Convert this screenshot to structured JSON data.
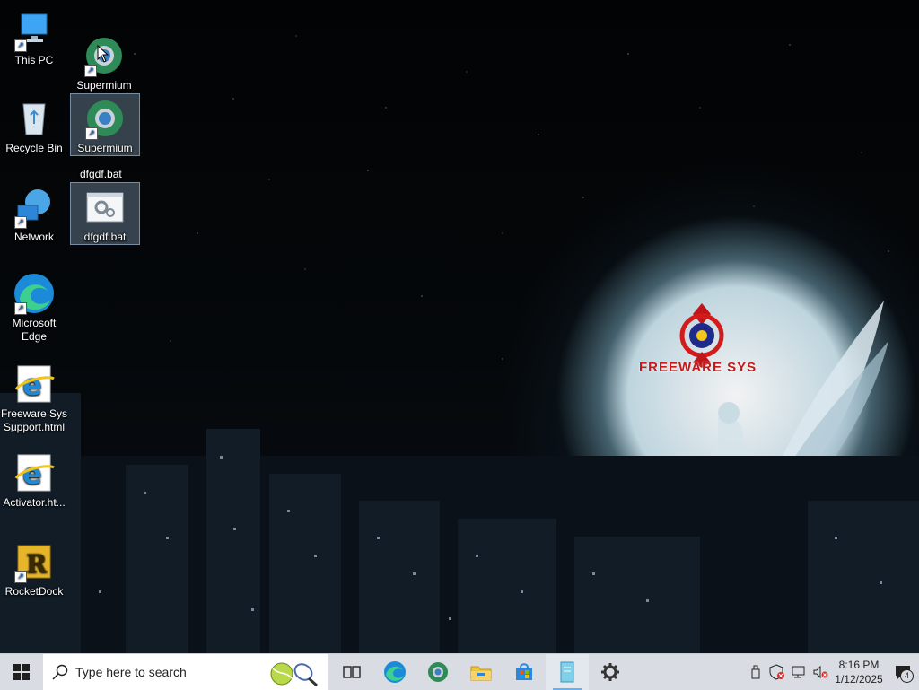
{
  "desktop": {
    "icons": [
      {
        "label": "This PC"
      },
      {
        "label": "Recycle Bin"
      },
      {
        "label": "Network"
      },
      {
        "label": "Microsoft Edge"
      },
      {
        "label": "Freeware Sys Support.html"
      },
      {
        "label": "Activator.ht..."
      },
      {
        "label": "RocketDock"
      },
      {
        "label": "Supermium"
      },
      {
        "label": "Supermium"
      },
      {
        "label": "dfgdf.bat"
      }
    ],
    "drag_ghost_label": "dfgdf.bat",
    "wallpaper_logo": "FREEWARE SYS"
  },
  "taskbar": {
    "search_placeholder": "Type here to search",
    "pinned": [
      "task-view-icon",
      "edge-icon",
      "supermium-icon",
      "file-explorer-icon",
      "store-icon",
      "notepad-icon",
      "settings-icon"
    ],
    "clock_time": "8:16 PM",
    "clock_date": "1/12/2025",
    "notification_count": "4"
  },
  "colors": {
    "taskbar_bg": "#d9dde3",
    "accent": "#0a58c7"
  }
}
